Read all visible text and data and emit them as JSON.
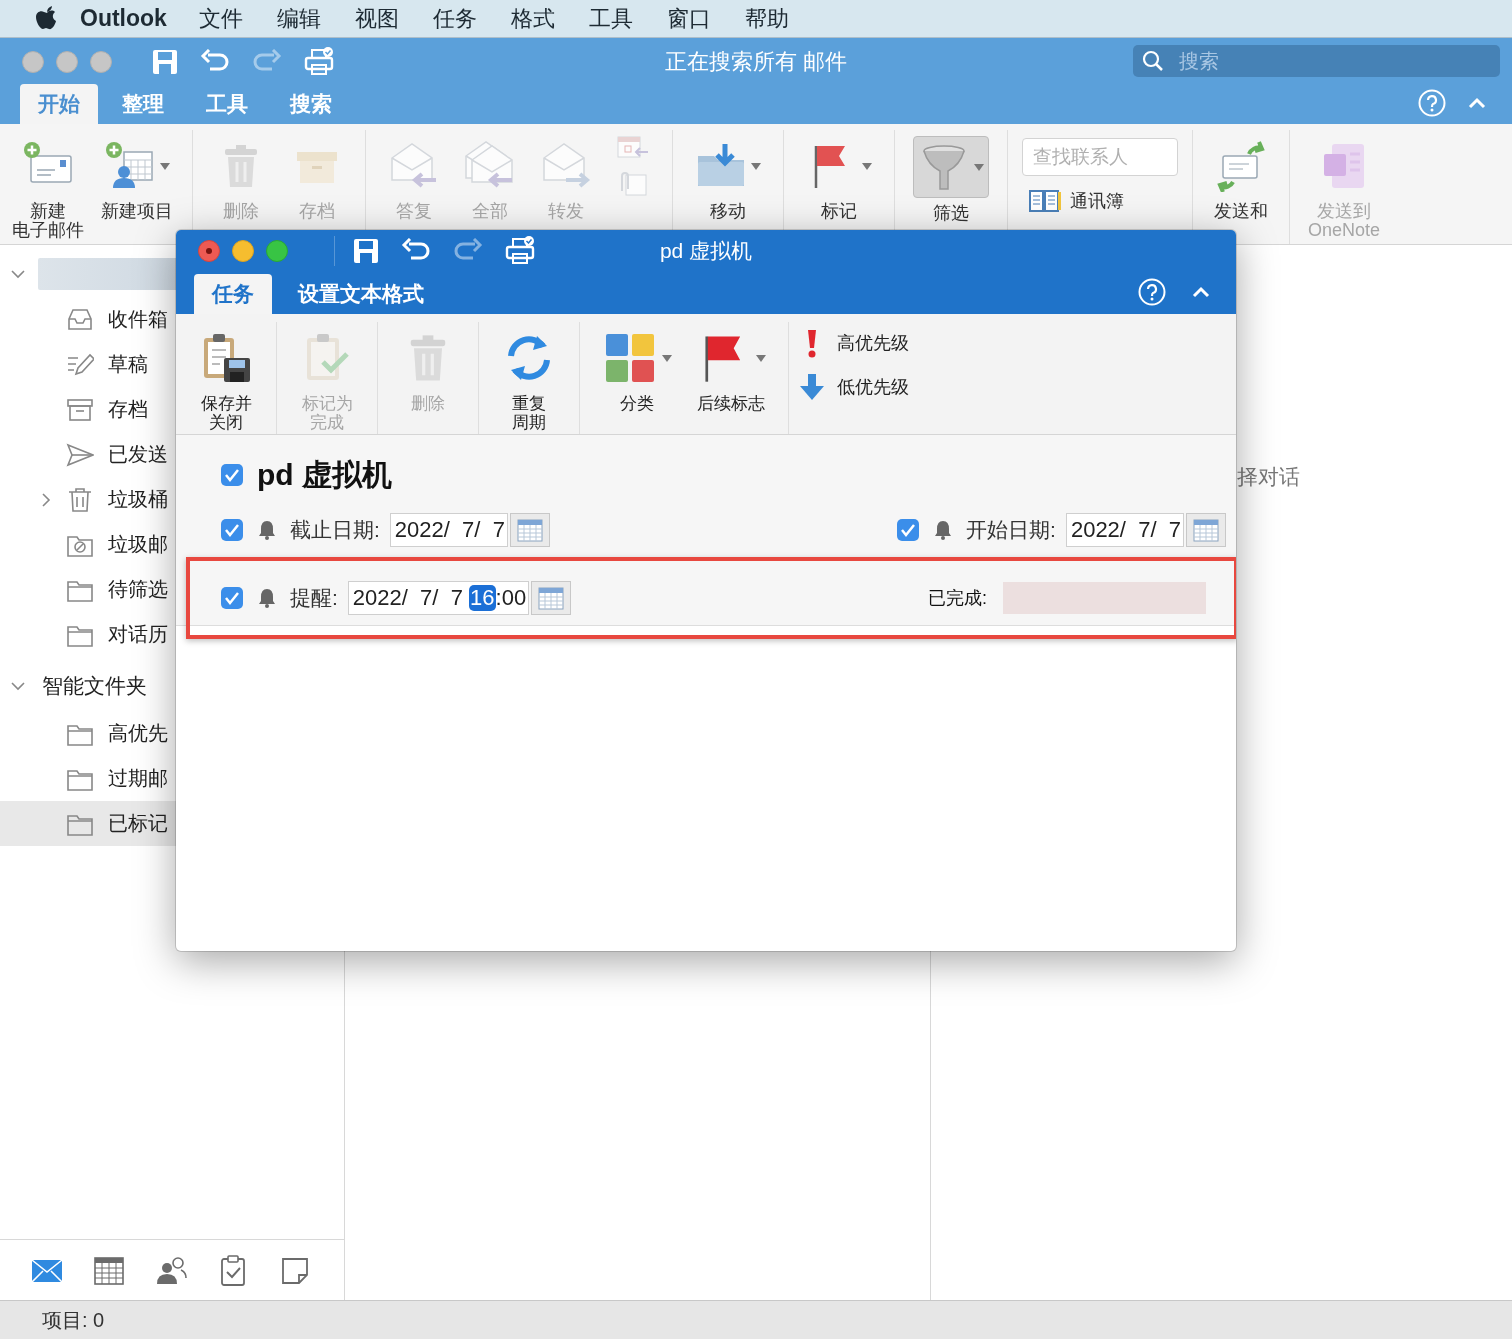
{
  "menu_bar": {
    "app": "Outlook",
    "items": [
      "文件",
      "编辑",
      "视图",
      "任务",
      "格式",
      "工具",
      "窗口",
      "帮助"
    ]
  },
  "main_window": {
    "title": "正在搜索所有 邮件",
    "search": {
      "placeholder": "搜索"
    },
    "tabs": [
      {
        "label": "开始",
        "selected": true
      },
      {
        "label": "整理",
        "selected": false
      },
      {
        "label": "工具",
        "selected": false
      },
      {
        "label": "搜索",
        "selected": false
      }
    ],
    "ribbon": [
      [
        {
          "kind": "new-mail",
          "lines": [
            "新建",
            "电子邮件"
          ],
          "disabled": false,
          "dropdown": false
        },
        {
          "kind": "new-item",
          "lines": [
            "新建项目"
          ],
          "disabled": false,
          "dropdown": true
        }
      ],
      [
        {
          "kind": "delete",
          "lines": [
            "删除"
          ],
          "disabled": true,
          "dropdown": false
        },
        {
          "kind": "archive",
          "lines": [
            "存档"
          ],
          "disabled": true,
          "dropdown": false
        }
      ],
      [
        {
          "kind": "reply",
          "lines": [
            "答复"
          ],
          "disabled": true,
          "dropdown": false
        },
        {
          "kind": "reply-all",
          "lines": [
            "全部"
          ],
          "disabled": true,
          "dropdown": false
        },
        {
          "kind": "forward",
          "lines": [
            "转发"
          ],
          "disabled": true,
          "dropdown": false
        },
        {
          "kind": "meeting",
          "disabled": true
        }
      ],
      [
        {
          "kind": "move",
          "lines": [
            "移动"
          ],
          "disabled": false,
          "dropdown": true
        }
      ],
      [
        {
          "kind": "flag",
          "lines": [
            "标记"
          ],
          "disabled": false,
          "dropdown": true
        }
      ],
      [
        {
          "kind": "filter",
          "lines": [
            "筛选"
          ],
          "disabled": false,
          "dropdown": true,
          "pressed": true
        }
      ],
      [
        {
          "kind": "contact-search",
          "placeholder": "查找联系人",
          "book": "通讯簿"
        }
      ],
      [
        {
          "kind": "send-receive",
          "lines": [
            "发送和"
          ],
          "disabled": false,
          "dropdown": false
        }
      ],
      [
        {
          "kind": "onenote",
          "lines": [
            "发送到",
            "OneNote"
          ],
          "disabled": true,
          "dropdown": false
        }
      ]
    ]
  },
  "sidebar": {
    "account": {
      "expanded": true,
      "children": [
        {
          "label": "收件箱",
          "kind": "inbox",
          "selected": false
        },
        {
          "label": "草稿",
          "kind": "drafts",
          "selected": false
        },
        {
          "label": "存档",
          "kind": "archive",
          "selected": false
        },
        {
          "label": "已发送",
          "kind": "sent",
          "selected": false
        },
        {
          "label": "垃圾桶",
          "kind": "trash",
          "selected": false,
          "expanded": false
        },
        {
          "label": "垃圾邮",
          "kind": "junk",
          "selected": false
        },
        {
          "label": "待筛选",
          "kind": "folder",
          "selected": false
        },
        {
          "label": "对话历",
          "kind": "folder",
          "selected": false
        }
      ]
    },
    "smart_folders": {
      "label": "智能文件夹",
      "expanded": true,
      "children": [
        {
          "label": "高优先",
          "kind": "folder",
          "selected": false
        },
        {
          "label": "过期邮",
          "kind": "folder",
          "selected": false
        },
        {
          "label": "已标记",
          "kind": "folder",
          "selected": true
        }
      ]
    }
  },
  "nav": [
    {
      "kind": "mail",
      "selected": true
    },
    {
      "kind": "calendar",
      "selected": false
    },
    {
      "kind": "people",
      "selected": false
    },
    {
      "kind": "tasks",
      "selected": false
    },
    {
      "kind": "notes",
      "selected": false
    }
  ],
  "reading_pane": {
    "text": "择对话"
  },
  "status_bar": {
    "text": "项目: 0"
  },
  "task_window": {
    "title": "pd 虚拟机",
    "tabs": [
      {
        "label": "任务",
        "selected": true
      },
      {
        "label": "设置文本格式",
        "selected": false
      }
    ],
    "ribbon": [
      [
        {
          "kind": "save-close",
          "lines": [
            "保存并",
            "关闭"
          ],
          "disabled": false,
          "dropdown": false
        }
      ],
      [
        {
          "kind": "mark-complete",
          "lines": [
            "标记为",
            "完成"
          ],
          "disabled": true,
          "dropdown": false
        }
      ],
      [
        {
          "kind": "delete",
          "lines": [
            "删除"
          ],
          "disabled": true,
          "dropdown": false
        }
      ],
      [
        {
          "kind": "recurrence",
          "lines": [
            "重复",
            "周期"
          ],
          "disabled": false,
          "dropdown": false
        }
      ],
      [
        {
          "kind": "categorize",
          "lines": [
            "分类"
          ],
          "disabled": false,
          "dropdown": true
        },
        {
          "kind": "follow-up",
          "lines": [
            "后续标志"
          ],
          "disabled": false,
          "dropdown": true
        }
      ]
    ],
    "priority": [
      {
        "kind": "high",
        "label": "高优先级"
      },
      {
        "kind": "low",
        "label": "低优先级"
      }
    ],
    "subject": {
      "checked": true,
      "text": "pd 虚拟机"
    },
    "due": {
      "checked": true,
      "label": "截止日期:",
      "value": "2022/  7/  7"
    },
    "start": {
      "checked": true,
      "label": "开始日期:",
      "value": "2022/  7/  7"
    },
    "reminder": {
      "checked": true,
      "label": "提醒:",
      "date": "2022/  7/  7 ",
      "hour": {
        "text": "16",
        "selected": true
      },
      "minutes": ":00"
    },
    "completed": {
      "label": "已完成:"
    }
  }
}
